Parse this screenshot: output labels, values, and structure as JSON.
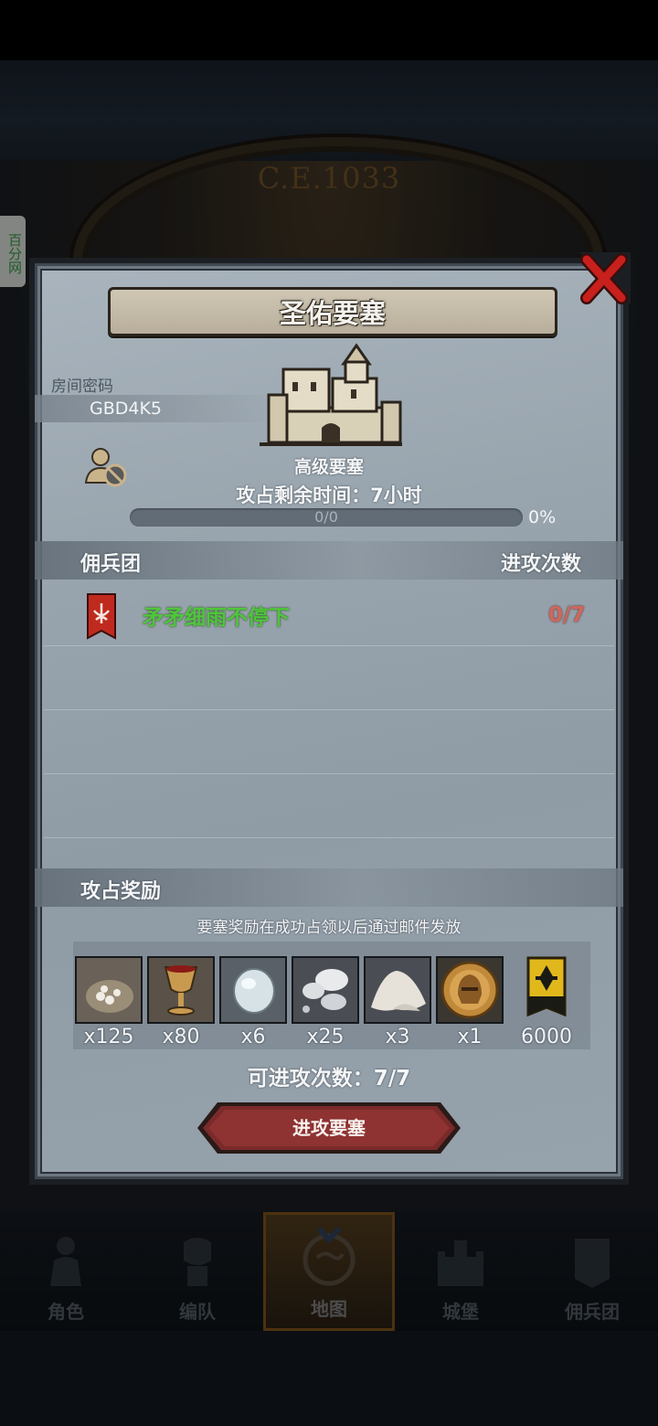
{
  "background": {
    "era_label": "C.E.1033",
    "side_tab_label": "百分网"
  },
  "modal": {
    "title": "圣佑要塞",
    "room": {
      "label": "房间密码",
      "code": "GBD4K5"
    },
    "fortress_level": "高级要塞",
    "time_left": "攻占剩余时间：7小时",
    "progress": {
      "text": "0/0",
      "percent_label": "0%",
      "fraction": 0
    },
    "mercenary_section": {
      "left_label": "佣兵团",
      "right_label": "进攻次数"
    },
    "mercenaries": [
      {
        "name": "矛矛细雨不停下",
        "attacks": "0/7"
      }
    ],
    "reward_section": {
      "title": "攻占奖励",
      "note": "要塞奖励在成功占领以后通过邮件发放"
    },
    "rewards": [
      {
        "icon": "ore-sack-icon",
        "qty": "x125"
      },
      {
        "icon": "goblet-icon",
        "qty": "x80"
      },
      {
        "icon": "moonstone-icon",
        "qty": "x6"
      },
      {
        "icon": "silver-mushroom-icon",
        "qty": "x25"
      },
      {
        "icon": "salt-pile-icon",
        "qty": "x3"
      },
      {
        "icon": "knight-helmet-coin-icon",
        "qty": "x1"
      },
      {
        "icon": "guild-banner-icon",
        "qty": "6000"
      }
    ],
    "attempts_left": "可进攻次数：7/7",
    "attack_button": "进攻要塞"
  },
  "bottom_nav": [
    {
      "label": "角色",
      "icon": "character-icon",
      "active": false
    },
    {
      "label": "编队",
      "icon": "formation-icon",
      "active": false
    },
    {
      "label": "地图",
      "icon": "map-icon",
      "active": true
    },
    {
      "label": "城堡",
      "icon": "castle-icon",
      "active": false
    },
    {
      "label": "佣兵团",
      "icon": "mercenary-icon",
      "active": false
    }
  ],
  "colors": {
    "mercenary_name": "#4fc63c",
    "attack_count": "#d0665c",
    "button": "#7a2a2a",
    "close_x": "#c8201c"
  }
}
